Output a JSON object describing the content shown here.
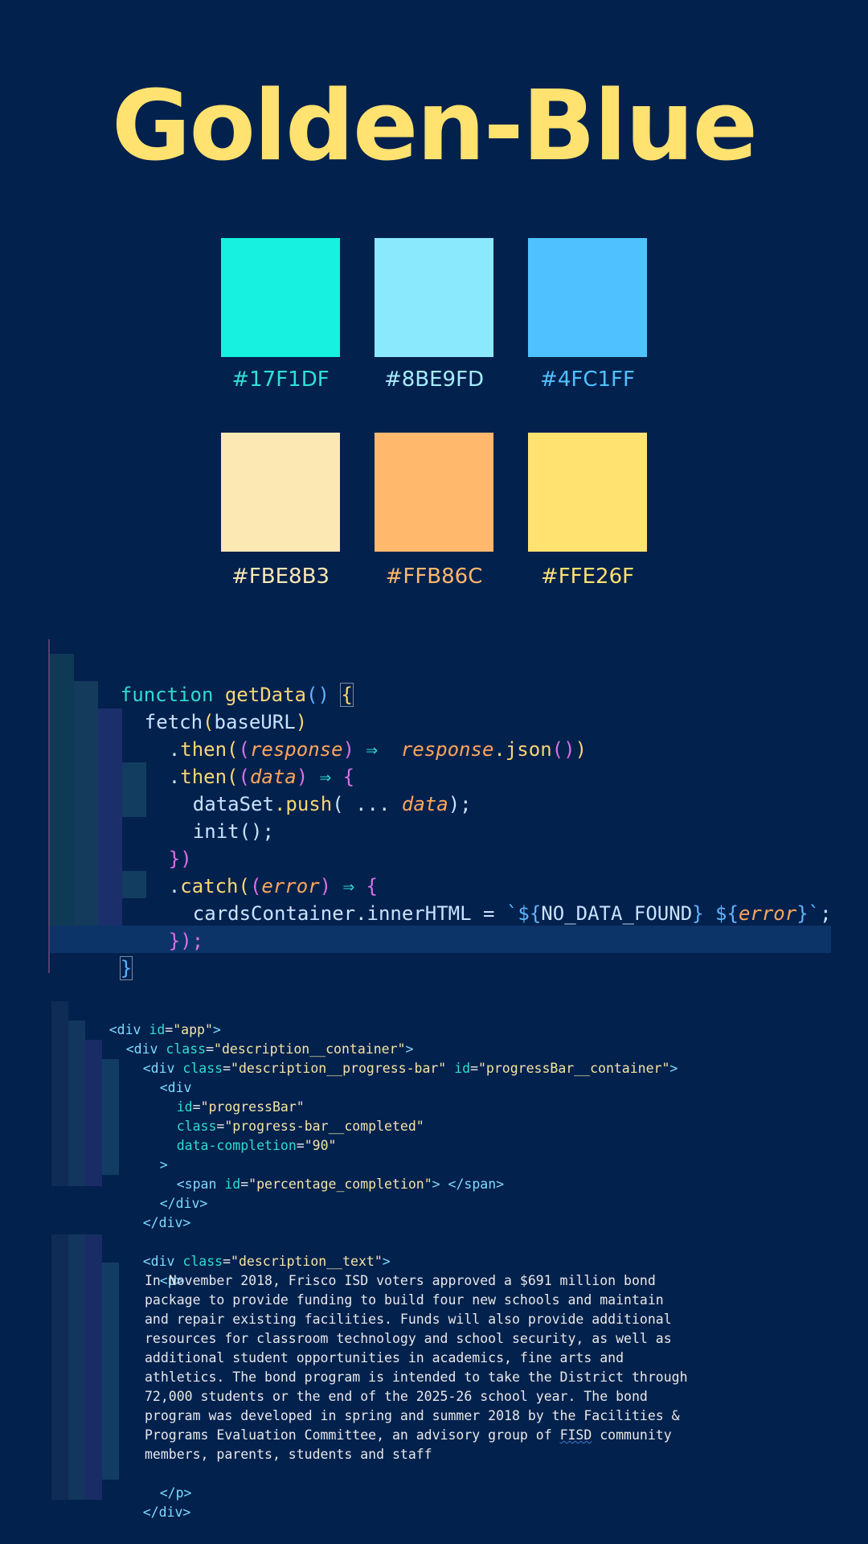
{
  "title": "Golden-Blue",
  "palette": [
    {
      "hex": "#17F1DF",
      "label": "#17F1DF",
      "label_color": "#2ee0d6"
    },
    {
      "hex": "#8BE9FD",
      "label": "#8BE9FD",
      "label_color": "#a6ecff"
    },
    {
      "hex": "#4FC1FF",
      "label": "#4FC1FF",
      "label_color": "#4fc1ff"
    },
    {
      "hex": "#FBE8B3",
      "label": "#FBE8B3",
      "label_color": "#fbe8b3"
    },
    {
      "hex": "#FFB86C",
      "label": "#FFB86C",
      "label_color": "#ffb86c"
    },
    {
      "hex": "#FFE26F",
      "label": "#FFE26F",
      "label_color": "#ffe26f"
    }
  ],
  "code_js": {
    "l1_kw": "function",
    "l1_fn": "getData",
    "l1_open": "()",
    "l1_brace": "{",
    "l2_fn": "fetch",
    "l2_arg": "baseURL",
    "l3_dot": ".",
    "l3_then": "then",
    "l3_param": "response",
    "l3_arrow": "⇒",
    "l3_obj": "response",
    "l3_method": ".json",
    "l4_then": "then",
    "l4_param": "data",
    "l5_obj": "dataSet",
    "l5_push": ".push",
    "l5_spread": "( ... ",
    "l5_param": "data",
    "l5_end": ");",
    "l6_init": "init",
    "l6_end": "();",
    "l7": "})",
    "l8_catch": "catch",
    "l8_param": "error",
    "l9_obj": "cardsContainer.innerHTML = ",
    "l9_tpl1": "`${",
    "l9_const": "NO_DATA_FOUND",
    "l9_tpl2": "} ${",
    "l9_err": "error",
    "l9_tpl3": "}`",
    "l9_end": ";",
    "l10": "});",
    "l11": "}"
  },
  "code_html": {
    "l1_open": "<div ",
    "l1_attr": "id",
    "l1_val": "\"app\"",
    "l1_close": ">",
    "l2_attr": "class",
    "l2_val": "\"description__container\"",
    "l3_attr": "class",
    "l3_val": "\"description__progress-bar\"",
    "l3_attr2": "id",
    "l3_val2": "\"progressBar__container\"",
    "l4": "<div",
    "l5_attr": "id",
    "l5_val": "\"progressBar\"",
    "l6_attr": "class",
    "l6_val": "\"progress-bar__completed\"",
    "l7_attr": "data-completion",
    "l7_val": "\"90\"",
    "l8": ">",
    "l9_open": "<span ",
    "l9_attr": "id",
    "l9_val": "\"percentage_completion\"",
    "l9_close": "> </span>",
    "l10": "</div>",
    "l11": "</div>",
    "l12_attr": "class",
    "l12_val": "\"description__text\"",
    "l13": "<p>",
    "text_lines": [
      "In November 2018, Frisco ISD voters approved a $691 million bond",
      "package to provide funding to build four new schools and maintain",
      "and repair existing facilities. Funds will also provide additional",
      "resources for classroom technology and school security, as well as",
      "additional student opportunities in academics, fine arts and",
      "athletics. The bond program is intended to take the District through",
      "72,000 students or the end of the 2025-26 school year. The bond",
      "program was developed in spring and summer 2018 by the Facilities &",
      "Programs Evaluation Committee, an advisory group of "
    ],
    "fisd": "FISD",
    "text_line9_end": " community",
    "text_last": "members, parents, students and staff",
    "l_p_close": "</p>",
    "l_div_close": "</div>"
  }
}
